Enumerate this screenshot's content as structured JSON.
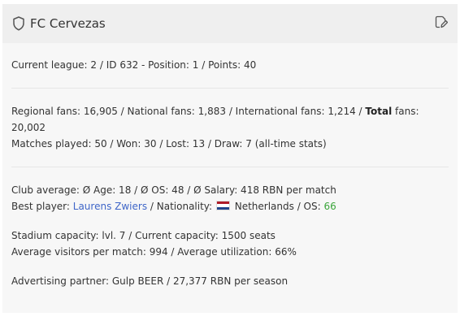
{
  "card": {
    "club_name": "FC Cervezas",
    "icons": {
      "club": "shield-icon",
      "edit": "edit-icon"
    }
  },
  "league_line": {
    "text": "Current league: 2 / ID 632 - Position: 1 / Points: 40"
  },
  "fans_line": {
    "prefix": "Regional fans: 16,905 / National fans: 1,883 / International fans: 1,214 / ",
    "total_label": "Total",
    "suffix": " fans: 20,002"
  },
  "matches_line": {
    "text": "Matches played: 50 / Won: 30 / Lost: 13 / Draw: 7 (all-time stats)"
  },
  "club_average_line": {
    "text": "Club average: Ø Age: 18 / Ø OS: 48 / Ø Salary: 418 RBN per match"
  },
  "best_player_line": {
    "prefix": "Best player: ",
    "player_name": "Laurens Zwiers",
    "nationality_label": " / Nationality: ",
    "nationality": "Netherlands",
    "os_label": " / OS: ",
    "os_value": "66",
    "flag_colors": [
      "#ae1c28",
      "#ffffff",
      "#21468b"
    ]
  },
  "stadium_line": {
    "text": "Stadium capacity: lvl. 7 / Current capacity: 1500 seats"
  },
  "visitors_line": {
    "text": "Average visitors per match: 994 / Average utilization: 66%"
  },
  "advertising_line": {
    "text": "Advertising partner: Gulp BEER / 27,377 RBN per season"
  },
  "colors": {
    "link": "#3f66c8",
    "os_value": "#3aa53a",
    "header_bg": "#efefef",
    "card_bg": "#f7f7f7"
  }
}
